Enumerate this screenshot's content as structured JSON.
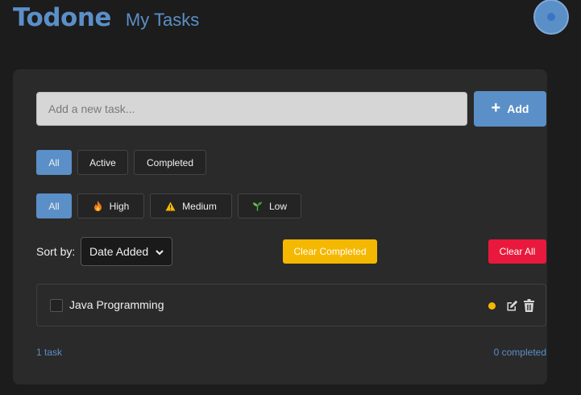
{
  "header": {
    "brand": "Todone",
    "subtitle": "My Tasks"
  },
  "input": {
    "placeholder": "Add a new task...",
    "value": "",
    "add_label": "Add"
  },
  "status_filters": [
    {
      "label": "All",
      "active": true
    },
    {
      "label": "Active",
      "active": false
    },
    {
      "label": "Completed",
      "active": false
    }
  ],
  "priority_filters": [
    {
      "label": "All",
      "icon": "",
      "active": true
    },
    {
      "label": "High",
      "icon": "fire-icon",
      "active": false
    },
    {
      "label": "Medium",
      "icon": "warning-icon",
      "active": false
    },
    {
      "label": "Low",
      "icon": "seedling-icon",
      "active": false
    }
  ],
  "sort": {
    "label": "Sort by:",
    "selected": "Date Added"
  },
  "actions": {
    "clear_completed": "Clear Completed",
    "clear_all": "Clear All"
  },
  "tasks": [
    {
      "text": "Java Programming",
      "completed": false,
      "priority": "medium",
      "priority_color": "#f5b800"
    }
  ],
  "footer": {
    "count": "1 task",
    "completed": "0 completed"
  },
  "colors": {
    "accent": "#5b8fc7",
    "warning": "#f5b800",
    "danger": "#e8193c"
  }
}
